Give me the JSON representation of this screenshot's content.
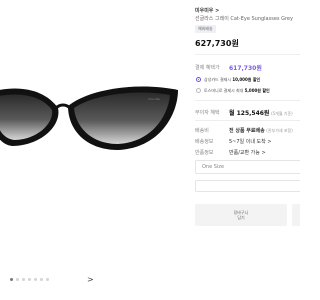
{
  "product": {
    "brand": "미우미우 >",
    "title": "선글라스 그레이 Cat-Eye Sunglasses Grey",
    "badge": "해외배송",
    "price": "627,730원"
  },
  "gallery": {
    "dots_total": 7,
    "active_dot": 0,
    "next_arrow": ">"
  },
  "discount": {
    "label": "결제 혜택가",
    "value": "617,730원",
    "options": [
      {
        "prefix": "삼성카드 결제시 ",
        "amount": "10,000원 할인",
        "checked": true
      },
      {
        "prefix": "토스머니로 결제시 최대 ",
        "amount": "5,000원 할인",
        "checked": false
      }
    ]
  },
  "installment": {
    "label": "무이자 혜택",
    "value": "월 125,546원",
    "note": "(5개월 기준)"
  },
  "shipping": {
    "label": "배송비",
    "value": "전 상품 무료배송",
    "note": "(관부가세 포함)"
  },
  "delivery": {
    "label": "배송정보",
    "value": "5~7일 이내 도착 >"
  },
  "origin": {
    "label": "반품정보",
    "value": "반품/교환 가능 >"
  },
  "option_select": {
    "placeholder": "One Size"
  },
  "buttons": {
    "cart": "장바구니\n담기",
    "second": ""
  },
  "colors": {
    "accent": "#6e4fe0",
    "discount_text": "#7c5be6"
  }
}
